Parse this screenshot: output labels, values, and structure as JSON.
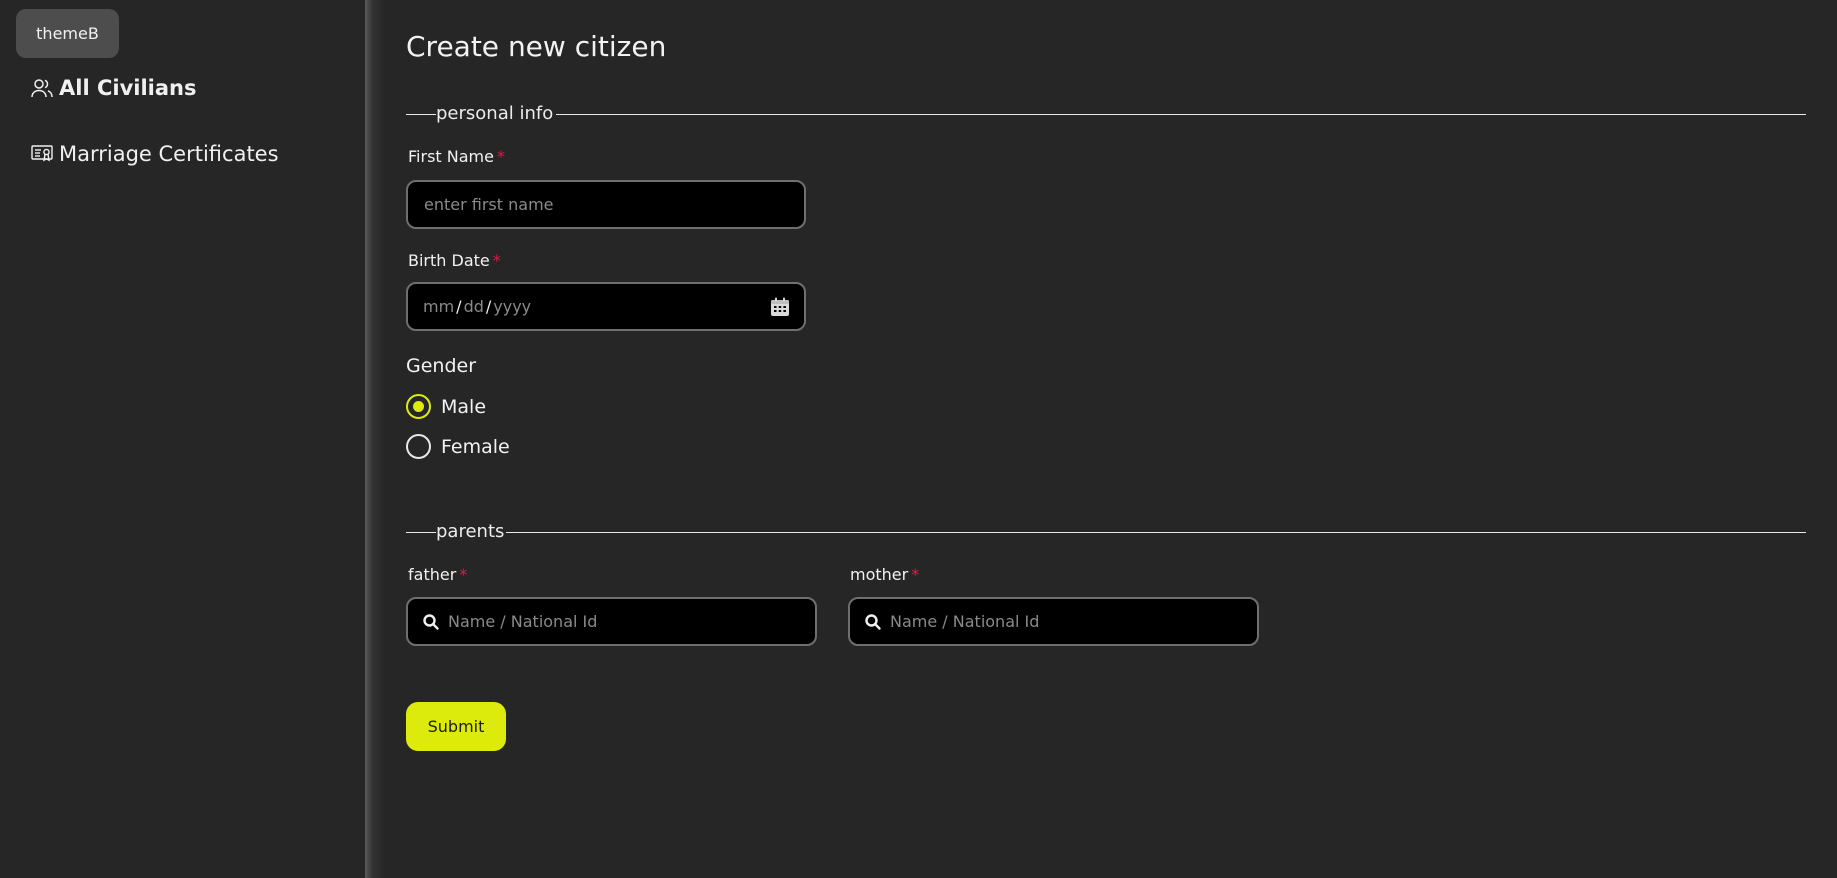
{
  "sidebar": {
    "theme_button": "themeB",
    "items": [
      {
        "label": "All Civilians",
        "icon": "users-icon",
        "active": true
      },
      {
        "label": "Marriage Certificates",
        "icon": "certificate-icon",
        "active": false
      }
    ]
  },
  "main": {
    "title": "Create new citizen",
    "personal_info": {
      "legend": "personal info",
      "first_name": {
        "label": "First Name",
        "required_mark": "*",
        "placeholder": "enter first name",
        "value": ""
      },
      "birth_date": {
        "label": "Birth Date",
        "required_mark": "*",
        "mm": "mm",
        "dd": "dd",
        "yyyy": "yyyy",
        "sep": "/"
      },
      "gender": {
        "label": "Gender",
        "options": [
          {
            "label": "Male",
            "checked": true
          },
          {
            "label": "Female",
            "checked": false
          }
        ]
      }
    },
    "parents": {
      "legend": "parents",
      "father": {
        "label": "father",
        "required_mark": "*",
        "placeholder": "Name / National Id"
      },
      "mother": {
        "label": "mother",
        "required_mark": "*",
        "placeholder": "Name / National Id"
      }
    },
    "submit_label": "Submit"
  },
  "colors": {
    "background": "#262626",
    "accent": "#dceb0c",
    "required": "#e0194a",
    "input_bg": "#000000",
    "input_border": "#6f6f6f"
  }
}
